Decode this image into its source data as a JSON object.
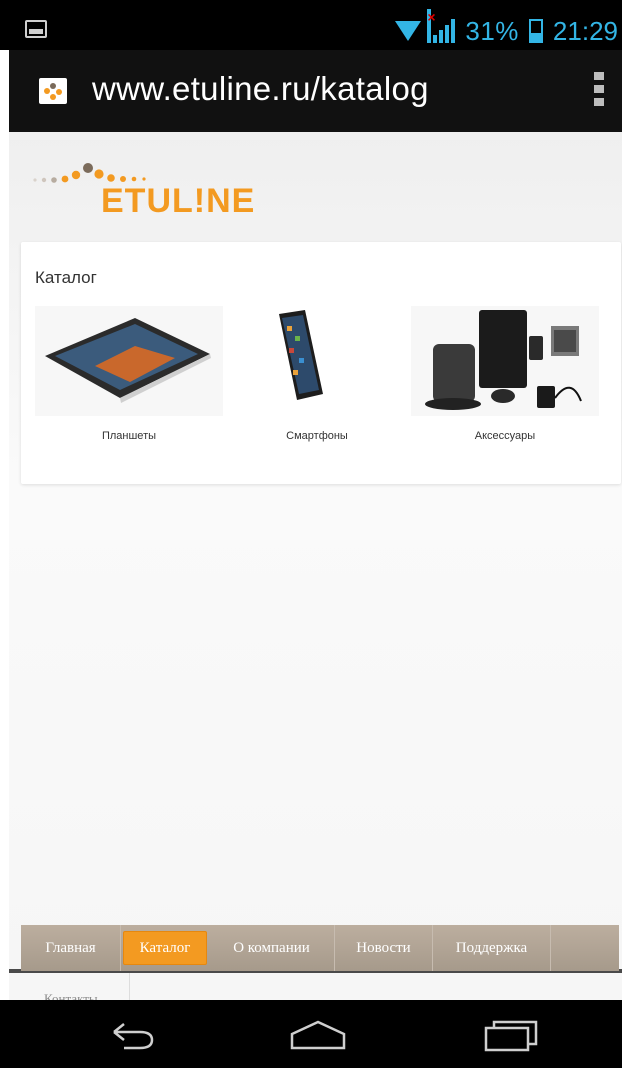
{
  "status_bar": {
    "battery_percent": "31%",
    "time": "21:29",
    "icons": [
      "gallery-notification-icon",
      "wifi-icon",
      "signal-icon",
      "battery-icon"
    ]
  },
  "browser": {
    "url": "www.etuline.ru/katalog",
    "icons": [
      "site-favicon",
      "overflow-menu-icon"
    ]
  },
  "site": {
    "logo_text": "ETUL!NE",
    "catalog": {
      "title": "Каталог",
      "items": [
        {
          "label": "Планшеты",
          "icon": "tablet-image"
        },
        {
          "label": "Смартфоны",
          "icon": "smartphone-image"
        },
        {
          "label": "Аксессуары",
          "icon": "accessories-image"
        }
      ]
    },
    "nav": {
      "items": [
        {
          "label": "Главная",
          "active": false
        },
        {
          "label": "Каталог",
          "active": true
        },
        {
          "label": "О компании",
          "active": false
        },
        {
          "label": "Новости",
          "active": false
        },
        {
          "label": "Поддержка",
          "active": false
        }
      ],
      "contacts_label": "Контакты"
    },
    "colors": {
      "accent": "#f39a21",
      "nav_bg": "#b5a99b"
    }
  },
  "system_nav": {
    "icons": [
      "back-icon",
      "home-icon",
      "recents-icon"
    ]
  }
}
